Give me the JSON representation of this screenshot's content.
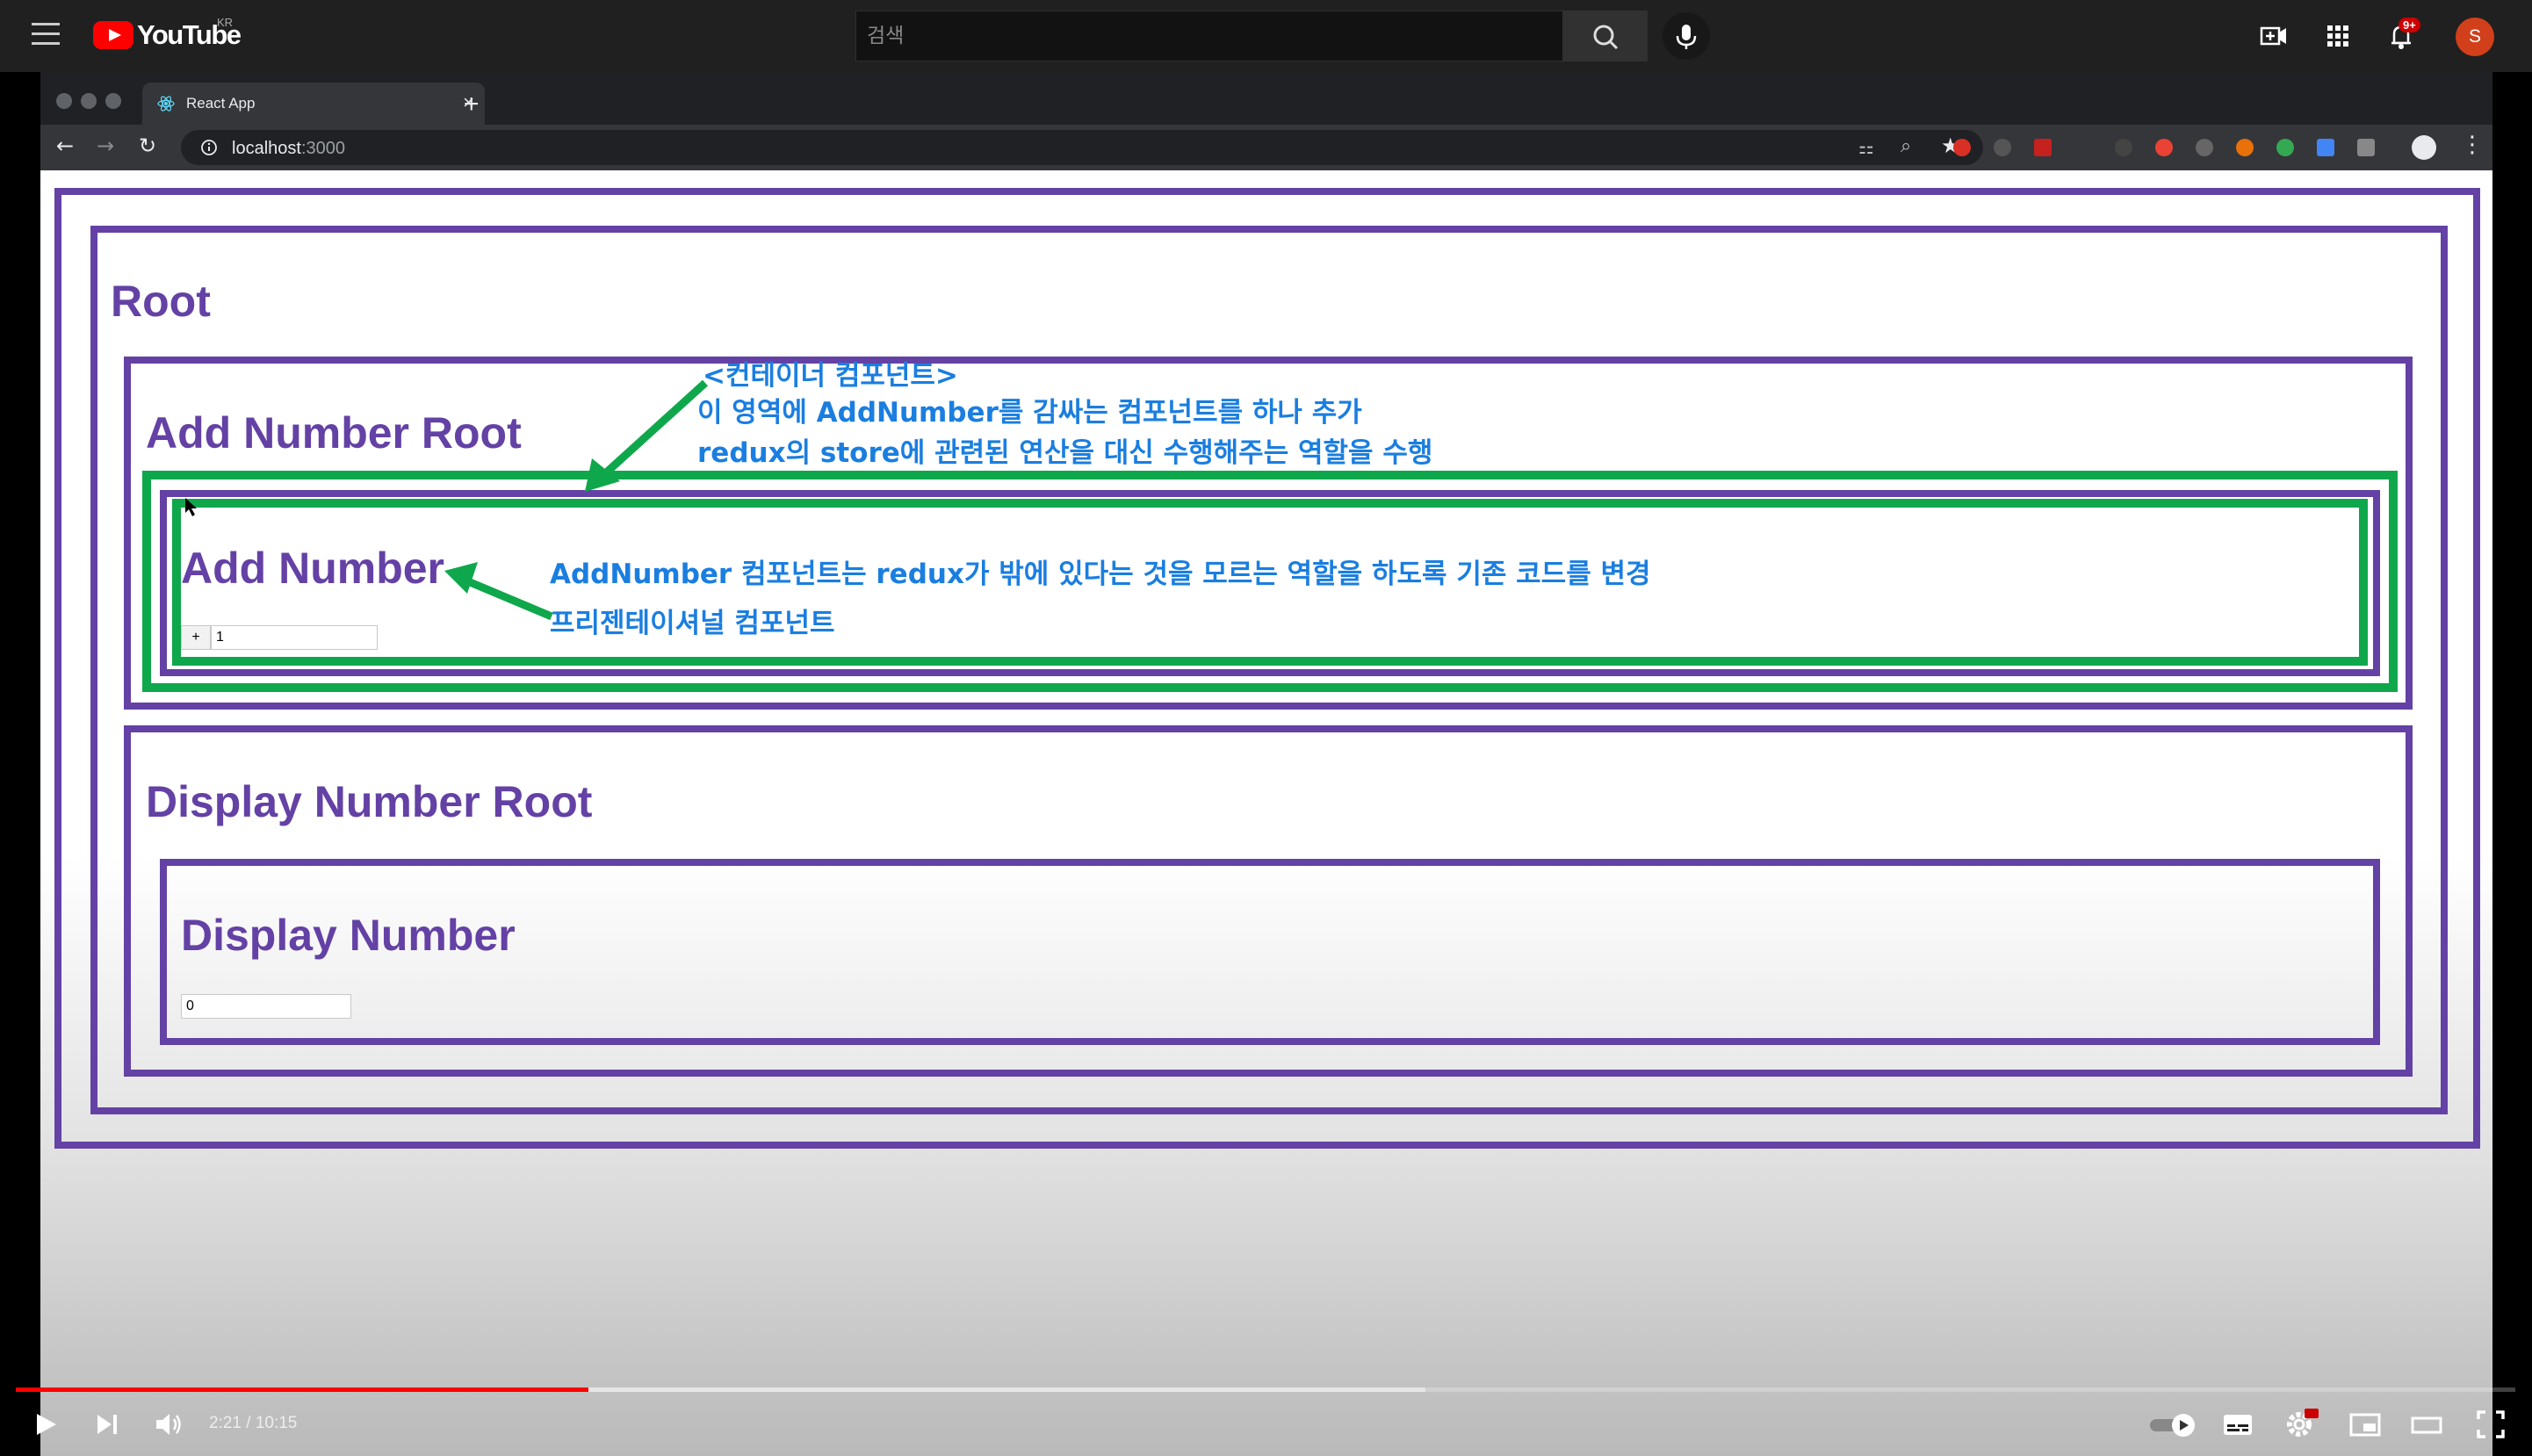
{
  "youtube": {
    "logo_text": "YouTube",
    "country": "KR",
    "search_placeholder": "검색",
    "notification_count": "9+",
    "avatar_letter": "S"
  },
  "browser": {
    "tab_title": "React App",
    "tab_close": "×",
    "new_tab": "+",
    "url_host": "localhost",
    "url_port": ":3000"
  },
  "app": {
    "root_title": "Root",
    "add_number_root_title": "Add Number Root",
    "add_number_title": "Add Number",
    "plus_label": "+",
    "add_input_value": "1",
    "display_number_root_title": "Display Number Root",
    "display_number_title": "Display Number",
    "display_input_value": "0"
  },
  "annotations": {
    "container_line1": "<컨테이너 컴포넌트>",
    "container_line2": "이 영역에 AddNumber를 감싸는 컴포넌트를 하나 추가",
    "container_line3": "redux의 store에 관련된 연산을 대신 수행해주는 역할을 수행",
    "presentational_line1": "AddNumber 컴포넌트는 redux가 밖에 있다는 것을 모르는 역할을 하도록 기존 코드를 변경",
    "presentational_line2": "프리젠테이셔널 컴포넌트"
  },
  "player": {
    "current_time": "2:21",
    "duration": "10:15",
    "time_separator": " / ",
    "progress_fraction": 0.229,
    "buffered_fraction": 0.564
  },
  "colors": {
    "component_border": "#6441a5",
    "annotation_green": "#0fa74b",
    "annotation_text": "#1a7ee0",
    "youtube_red": "#ff0000"
  }
}
